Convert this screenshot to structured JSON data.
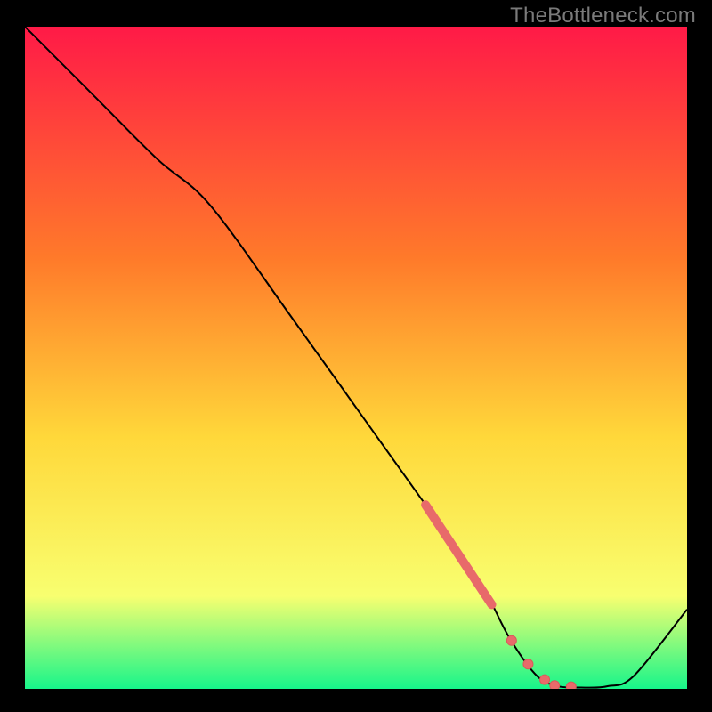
{
  "watermark": "TheBottleneck.com",
  "colors": {
    "gradient_top": "#ff1a47",
    "gradient_mid1": "#ff7a2a",
    "gradient_mid2": "#ffd83a",
    "gradient_mid3": "#f8ff70",
    "gradient_bottom": "#17f58a",
    "curve": "#000000",
    "marker": "#e86a6a",
    "marker_stroke": "#d85a5a"
  },
  "chart_data": {
    "type": "line",
    "title": "",
    "xlabel": "",
    "ylabel": "",
    "xlim": [
      0,
      100
    ],
    "ylim": [
      0,
      100
    ],
    "x": [
      0,
      10,
      20,
      28,
      40,
      50,
      60,
      68.5,
      73,
      77,
      80,
      84,
      88,
      92,
      100
    ],
    "values": [
      100,
      90,
      80,
      73,
      56.5,
      42.5,
      28.5,
      16.5,
      8,
      2.3,
      0.5,
      0.2,
      0.4,
      2,
      12
    ],
    "highlight_segment": {
      "x_start": 60.5,
      "x_end": 70.5
    },
    "markers_x": [
      73.5,
      76.0,
      78.5,
      80.0,
      82.5
    ],
    "grid": false,
    "legend": false
  }
}
